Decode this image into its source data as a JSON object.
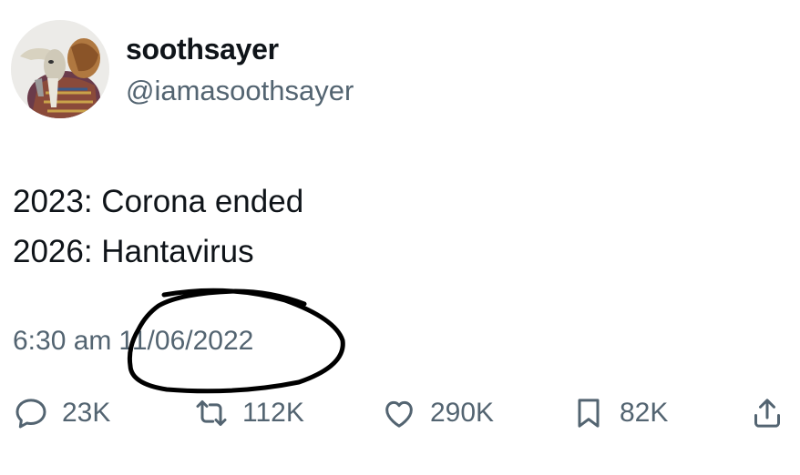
{
  "author": {
    "display_name": "soothsayer",
    "handle": "@iamasoothsayer"
  },
  "tweet": {
    "lines": [
      "2023: Corona ended",
      "2026: Hantavirus"
    ],
    "time": "6:30 am",
    "date": "11/06/2022"
  },
  "actions": {
    "replies": "23K",
    "retweets": "112K",
    "likes": "290K",
    "bookmarks": "82K"
  },
  "colors": {
    "text": "#0f1419",
    "muted": "#536471",
    "circle_ink": "#000000"
  }
}
